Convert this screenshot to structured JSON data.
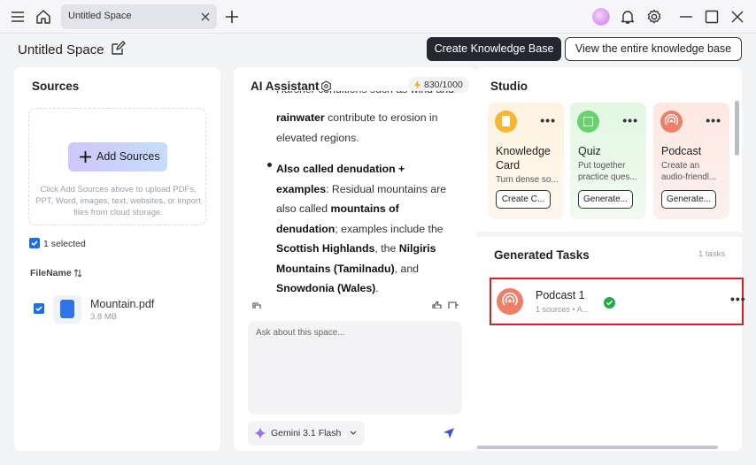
{
  "tab": {
    "title": "Untitled Space"
  },
  "header": {
    "space_title": "Untitled Space",
    "create_kb": "Create Knowledge Base",
    "view_kb": "View the entire knowledge base"
  },
  "sources": {
    "title": "Sources",
    "add_button": "Add Sources",
    "hint": "Click Add Sources above to upload PDFs, PPT, Word, images, text, websites, or import files from cloud storage.",
    "selected": "1 selected",
    "column": "FileName",
    "files": [
      {
        "name": "Mountain.pdf",
        "size": "3.8 MB"
      }
    ]
  },
  "assistant": {
    "title": "AI Assistant",
    "credits": "830/1000",
    "cut_line": "Harsher conditions such as wind and",
    "p1": {
      "b1": "rainwater",
      "t1": " contribute to erosion in elevated regions."
    },
    "p2": {
      "b1": "Also called denudation + examples",
      "t1": ": Residual mountains are also called ",
      "b2": "mountains of denudation",
      "t2": "; examples include the ",
      "b3": "Scottish Highlands",
      "t3": ", the ",
      "b4": "Nilgiris Mountains (Tamilnadu)",
      "t4": ", and ",
      "b5": "Snowdonia (Wales)",
      "t5": "."
    },
    "input_placeholder": "Ask about this space...",
    "model": "Gemini 3.1 Flash"
  },
  "studio": {
    "title": "Studio",
    "cards": [
      {
        "title": "Knowledge Card",
        "desc": "Turn dense so...",
        "button": "Create C...",
        "color": "#fdf1df",
        "icon_color": "#f5b632"
      },
      {
        "title": "Quiz",
        "desc": "Put together practice ques...",
        "button": "Generate...",
        "color": "#e4f7e4",
        "icon_color": "#68d26f"
      },
      {
        "title": "Podcast",
        "desc": "Create an audio-friendl...",
        "button": "Generate...",
        "color": "#fce9e3",
        "icon_color": "#ef7e69"
      }
    ],
    "generated_title": "Generated Tasks",
    "task_count": "1 tasks",
    "tasks": [
      {
        "name": "Podcast 1",
        "meta": "1 sources • A..."
      }
    ]
  }
}
